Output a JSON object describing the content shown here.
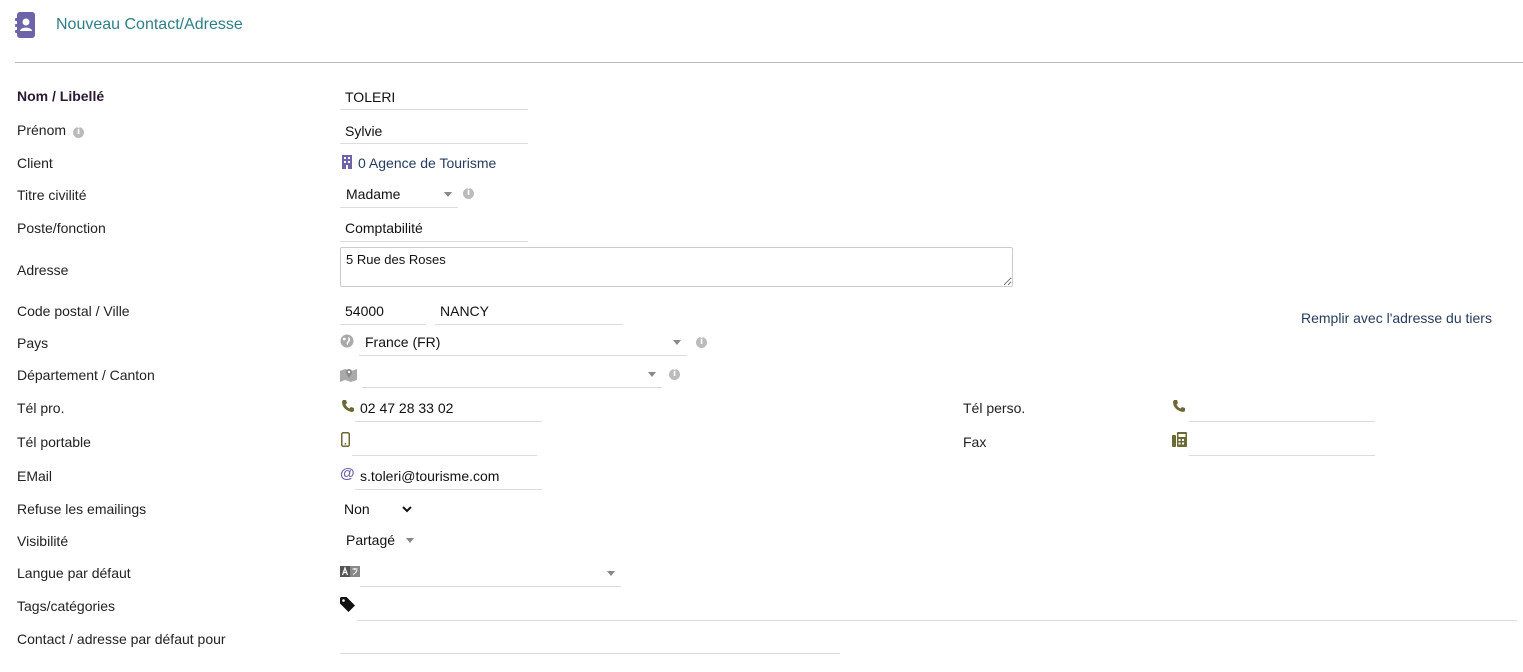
{
  "header": {
    "title": "Nouveau Contact/Adresse",
    "icon": "address-book-icon"
  },
  "colors": {
    "accent": "#2f7f86",
    "icon_purple": "#6c63a8",
    "icon_olive": "#6b6a34",
    "link": "#263c5c"
  },
  "form": {
    "nom": {
      "label": "Nom / Libellé",
      "value": "TOLERI"
    },
    "prenom": {
      "label": "Prénom",
      "value": "Sylvie"
    },
    "client": {
      "label": "Client",
      "value": "0 Agence de Tourisme"
    },
    "titre": {
      "label": "Titre civilité",
      "value": "Madame"
    },
    "poste": {
      "label": "Poste/fonction",
      "value": "Comptabilité"
    },
    "adresse": {
      "label": "Adresse",
      "value": "5 Rue des Roses"
    },
    "cp_ville": {
      "label": "Code postal / Ville",
      "cp": "54000",
      "ville": "NANCY"
    },
    "fill_link": "Remplir avec l'adresse du tiers",
    "pays": {
      "label": "Pays",
      "value": "France (FR)"
    },
    "departement": {
      "label": "Département / Canton",
      "value": ""
    },
    "tel_pro": {
      "label": "Tél pro.",
      "value": "02 47 28 33 02"
    },
    "tel_perso": {
      "label": "Tél perso.",
      "value": ""
    },
    "tel_portable": {
      "label": "Tél portable",
      "value": ""
    },
    "fax": {
      "label": "Fax",
      "value": ""
    },
    "email": {
      "label": "EMail",
      "value": "s.toleri@tourisme.com"
    },
    "refuse": {
      "label": "Refuse les emailings",
      "value": "Non"
    },
    "visibilite": {
      "label": "Visibilité",
      "value": "Partagé"
    },
    "langue": {
      "label": "Langue par défaut",
      "value": ""
    },
    "tags": {
      "label": "Tags/catégories",
      "value": ""
    },
    "default_for": {
      "label": "Contact / adresse par défaut pour",
      "value": ""
    }
  }
}
